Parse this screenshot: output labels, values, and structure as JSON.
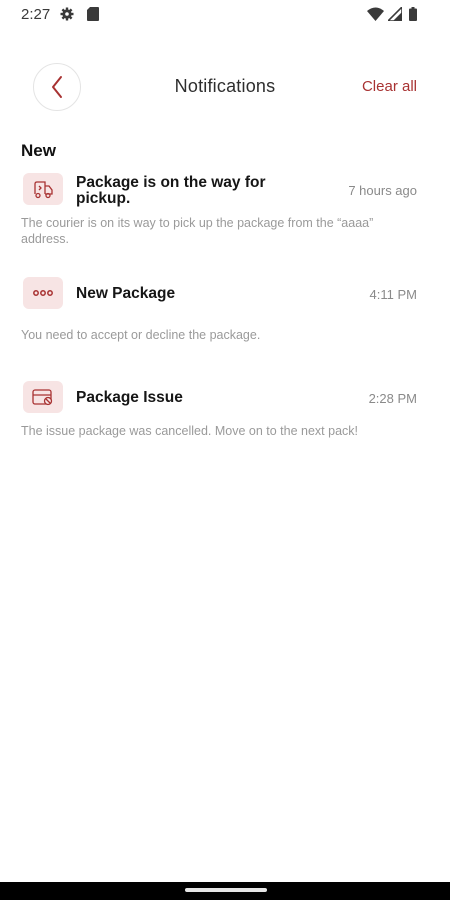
{
  "status_bar": {
    "time": "2:27",
    "icons": [
      "gear-icon",
      "sim-card-icon",
      "wifi-icon",
      "signal-icon",
      "battery-icon"
    ]
  },
  "header": {
    "back_icon": "chevron-left-icon",
    "title": "Notifications",
    "clear_all_label": "Clear all"
  },
  "section": {
    "title": "New"
  },
  "notifications": [
    {
      "icon": "truck-icon",
      "title": "Package is on the way for pickup.",
      "time": "7 hours ago",
      "description": "The courier is on its way to pick up the package from the “aaaa” address."
    },
    {
      "icon": "more-dots-icon",
      "title": "New Package",
      "time": "4:11 PM",
      "description": "You need to accept or decline the package."
    },
    {
      "icon": "card-issue-icon",
      "title": "Package Issue",
      "time": "2:28 PM",
      "description": "The issue package was cancelled. Move on to the next pack!"
    }
  ],
  "colors": {
    "accent": "#a83232",
    "icon_bg": "#f7e4e4",
    "muted_text": "#9a9a9a"
  }
}
